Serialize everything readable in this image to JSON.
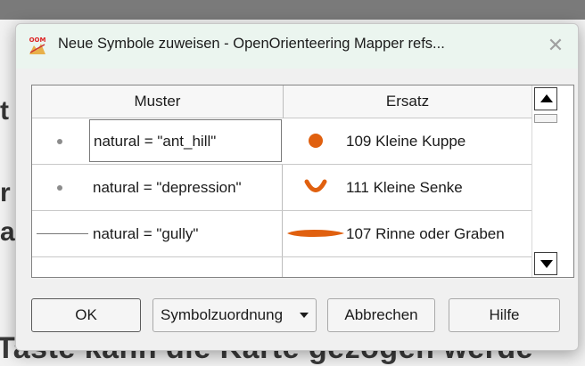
{
  "background": {
    "text_bottom": "Taste kann die Karte gezogen werde",
    "glyph_1": "t",
    "glyph_2": "r",
    "glyph_3": "a"
  },
  "dialog": {
    "title": "Neue Symbole zuweisen - OpenOrienteering Mapper refs...",
    "app_icon_label": "OOM",
    "close_glyph": "✕"
  },
  "table": {
    "columns": [
      "Muster",
      "Ersatz"
    ],
    "rows": [
      {
        "pattern": "natural = \"ant_hill\"",
        "replacement": "109 Kleine Kuppe",
        "pattern_icon": "gray-dot-icon",
        "symbol_icon": "orange-dot-icon"
      },
      {
        "pattern": "natural = \"depression\"",
        "replacement": "111 Kleine Senke",
        "pattern_icon": "gray-dot-icon",
        "symbol_icon": "orange-depression-icon"
      },
      {
        "pattern": "natural = \"gully\"",
        "replacement": "107 Rinne oder Graben",
        "pattern_icon": "line-icon",
        "symbol_icon": "orange-gully-icon"
      }
    ]
  },
  "buttons": {
    "ok": "OK",
    "symbol_mapping": "Symbolzuordnung",
    "cancel": "Abbrechen",
    "help": "Hilfe"
  },
  "colors": {
    "symbol_orange": "#e0600f",
    "titlebar": "#ebf5ef"
  }
}
